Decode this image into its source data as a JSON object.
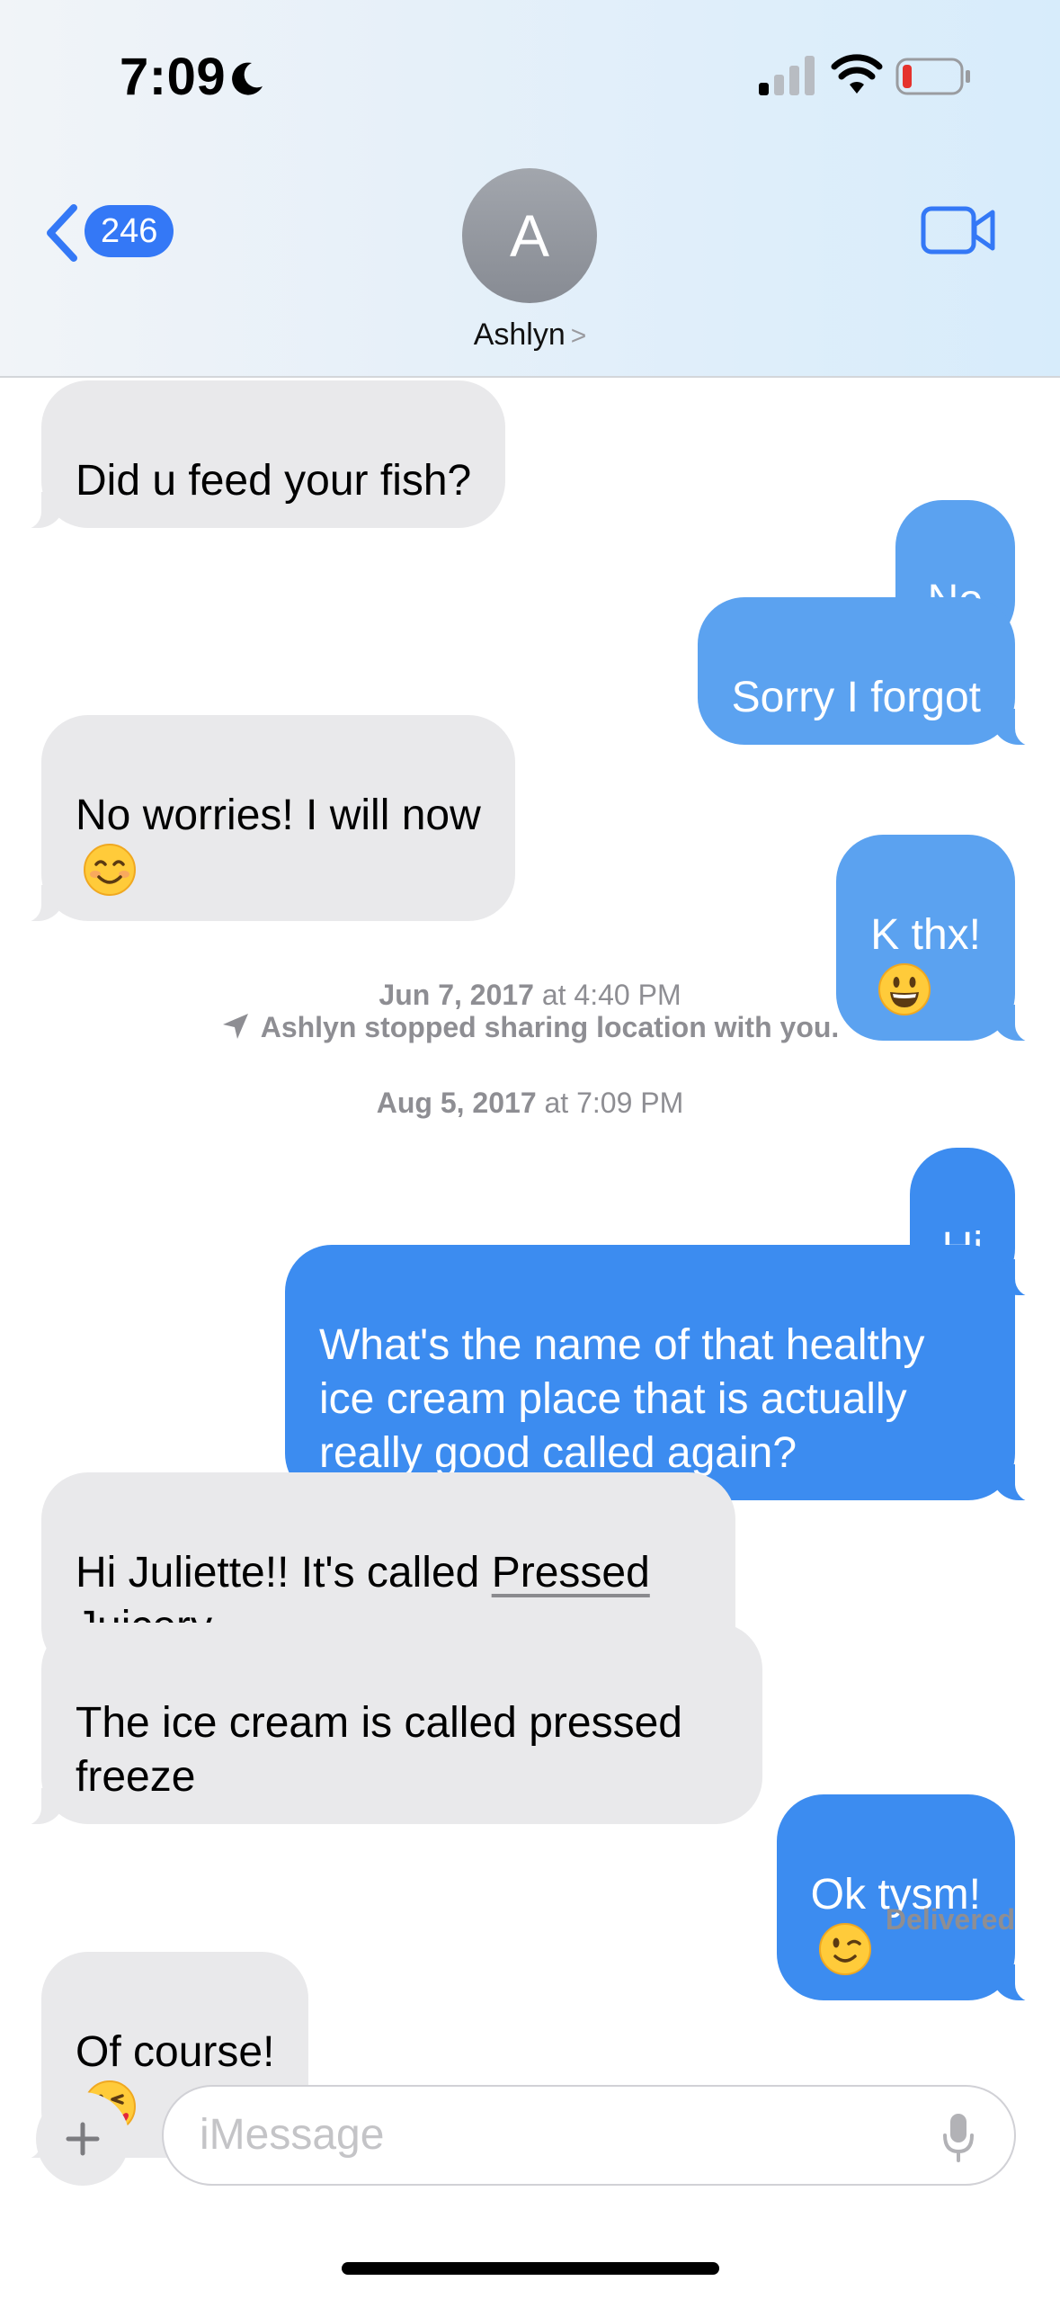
{
  "status_bar": {
    "time": "7:09"
  },
  "header": {
    "back_count": "246",
    "avatar_initial": "A",
    "contact_name": "Ashlyn",
    "contact_chevron": ">"
  },
  "messages": [
    {
      "from": "them",
      "text": "Did u feed your fish?"
    },
    {
      "from": "me",
      "text": "No"
    },
    {
      "from": "me",
      "text": "Sorry I forgot"
    },
    {
      "from": "them",
      "text": "No worries! I will now",
      "emoji": "smiling-face-icon"
    },
    {
      "from": "me",
      "text": "K thx!",
      "emoji": "grinning-face-icon"
    },
    {
      "from": "me",
      "text": "Hi"
    },
    {
      "from": "me",
      "text": "What's the name of that healthy ice cream place that is actually really good called again?"
    },
    {
      "from": "them",
      "text_a": "Hi Juliette!! It's called ",
      "link": "Pressed Juicery"
    },
    {
      "from": "them",
      "text": "The ice cream is called pressed freeze"
    },
    {
      "from": "me",
      "text": "Ok tysm!",
      "emoji": "winking-face-icon"
    },
    {
      "from": "them",
      "text": "Of course!",
      "emoji": "face-blowing-kiss-icon"
    }
  ],
  "timestamps": {
    "first_date": "Jun 7, 2017",
    "first_time": "at 4:40 PM",
    "location_note": "Ashlyn stopped sharing location with you.",
    "second_date": "Aug 5, 2017",
    "second_time": "at 7:09 PM"
  },
  "delivered_label": "Delivered",
  "composer": {
    "placeholder": "iMessage"
  },
  "colors": {
    "sent_bubble": "#3c8cf0",
    "received_bubble": "#e9e9eb",
    "accent": "#3478f6"
  }
}
